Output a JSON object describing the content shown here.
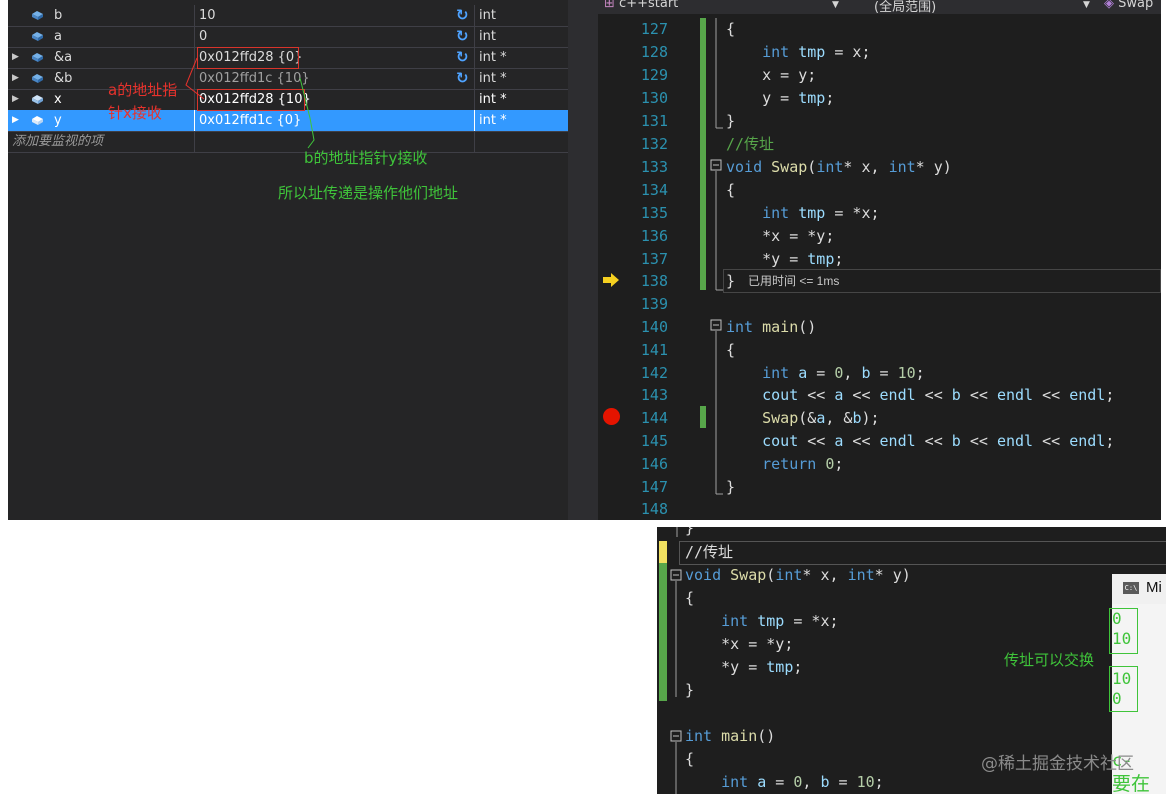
{
  "watch": {
    "rows": [
      {
        "name": "b",
        "value": "10",
        "type": "int"
      },
      {
        "name": "a",
        "value": "0",
        "type": "int"
      },
      {
        "name": "&a",
        "value": "0x012ffd28 {0}",
        "type": "int *"
      },
      {
        "name": "&b",
        "value": "0x012ffd1c {10}",
        "type": "int *"
      },
      {
        "name": "x",
        "value": "0x012ffd28 {10}",
        "type": "int *"
      },
      {
        "name": "y",
        "value": "0x012ffd1c {0}",
        "type": "int *"
      }
    ],
    "add_placeholder": "添加要监视的项"
  },
  "annotations": {
    "a_pointer_line1": "a的地址指",
    "a_pointer_line2": "针x接收",
    "b_pointer": "b的地址指针y接收",
    "conclusion": "所以址传递是操作他们地址",
    "swap_works": "传址可以交换"
  },
  "editor": {
    "toolbar": {
      "project": "c++start",
      "scope": "(全局范围)",
      "member": "Swap"
    },
    "lines": [
      {
        "num": "127",
        "code": "{"
      },
      {
        "num": "128",
        "code": "    int tmp = x;"
      },
      {
        "num": "129",
        "code": "    x = y;"
      },
      {
        "num": "130",
        "code": "    y = tmp;"
      },
      {
        "num": "131",
        "code": "}"
      },
      {
        "num": "132",
        "code": "//传址"
      },
      {
        "num": "133",
        "code": "void Swap(int* x, int* y)"
      },
      {
        "num": "134",
        "code": "{"
      },
      {
        "num": "135",
        "code": "    int tmp = *x;"
      },
      {
        "num": "136",
        "code": "    *x = *y;"
      },
      {
        "num": "137",
        "code": "    *y = tmp;"
      },
      {
        "num": "138",
        "code": "}"
      },
      {
        "num": "139",
        "code": ""
      },
      {
        "num": "140",
        "code": "int main()"
      },
      {
        "num": "141",
        "code": "{"
      },
      {
        "num": "142",
        "code": "    int a = 0, b = 10;"
      },
      {
        "num": "143",
        "code": "    cout << a << endl << b << endl << endl;"
      },
      {
        "num": "144",
        "code": "    Swap(&a, &b);"
      },
      {
        "num": "145",
        "code": "    cout << a << endl << b << endl << endl;"
      },
      {
        "num": "146",
        "code": "    return 0;"
      },
      {
        "num": "147",
        "code": "}"
      },
      {
        "num": "148",
        "code": ""
      }
    ],
    "elapsed_tip": "已用时间 <= 1ms"
  },
  "code2": {
    "lines": [
      "}",
      "//传址",
      "void Swap(int* x, int* y)",
      "{",
      "    int tmp = *x;",
      "    *x = *y;",
      "    *y = tmp;",
      "}",
      "",
      "int main()",
      "{",
      "    int a = 0, b = 10;"
    ],
    "console_title": "Mi",
    "console_output": [
      "0",
      "10",
      "10",
      "0"
    ],
    "watermark": "@稀土掘金技术社区",
    "cut_text_1": "c-",
    "cut_text_2": "要在调"
  },
  "colors": {
    "selection": "#3399ff",
    "annotation_red": "#e8322c",
    "annotation_green": "#3fc43a"
  }
}
